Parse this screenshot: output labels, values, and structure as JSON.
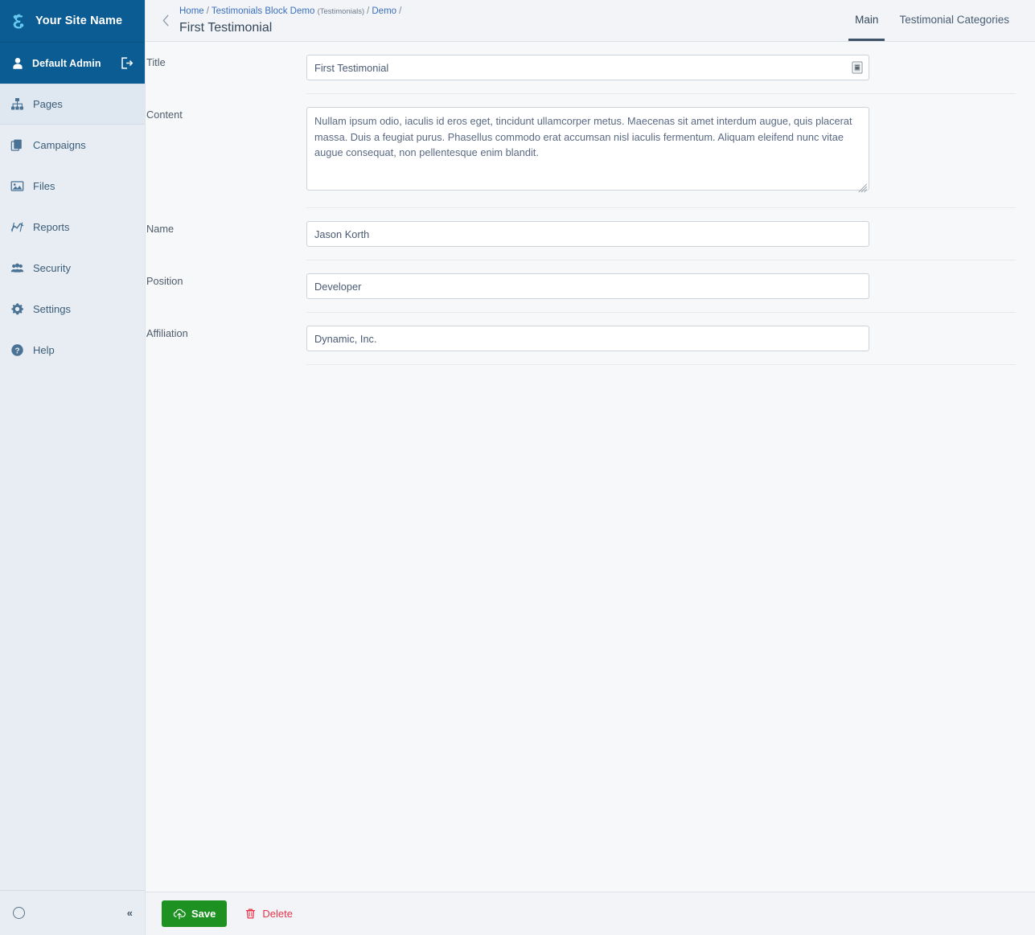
{
  "sidebar": {
    "brand": {
      "label": "Your Site Name",
      "logo_icon": "swirl-logo-icon"
    },
    "user": {
      "name": "Default Admin",
      "user_icon": "user-icon",
      "logout_icon": "logout-icon"
    },
    "items": [
      {
        "label": "Pages",
        "icon": "sitemap-icon",
        "active": true
      },
      {
        "label": "Campaigns",
        "icon": "copy-pages-icon",
        "active": false
      },
      {
        "label": "Files",
        "icon": "image-icon",
        "active": false
      },
      {
        "label": "Reports",
        "icon": "line-chart-icon",
        "active": false
      },
      {
        "label": "Security",
        "icon": "users-icon",
        "active": false
      },
      {
        "label": "Settings",
        "icon": "gear-icon",
        "active": false
      },
      {
        "label": "Help",
        "icon": "question-circle-icon",
        "active": false
      }
    ],
    "footer": {
      "status_icon": "circle-icon",
      "collapse_label": "«"
    }
  },
  "topbar": {
    "back_icon": "chevron-left-icon",
    "breadcrumb": [
      {
        "label": "Home",
        "sub": ""
      },
      {
        "label": "Testimonials Block Demo",
        "sub": "(Testimonials)"
      },
      {
        "label": "Demo",
        "sub": ""
      }
    ],
    "separator": "/",
    "page_title": "First Testimonial",
    "tabs": [
      {
        "label": "Main",
        "active": true
      },
      {
        "label": "Testimonial Categories",
        "active": false
      }
    ]
  },
  "form": {
    "fields": [
      {
        "label": "Title",
        "type": "text",
        "value": "First Testimonial",
        "placeholder": "",
        "icon": "insert-content-icon"
      },
      {
        "label": "Content",
        "type": "textarea",
        "value": "Nullam ipsum odio, iaculis id eros eget, tincidunt ullamcorper metus. Maecenas sit amet interdum augue, quis placerat massa. Duis a feugiat purus. Phasellus commodo erat accumsan nisl iaculis fermentum. Aliquam eleifend nunc vitae augue consequat, non pellentesque enim blandit.",
        "placeholder": ""
      },
      {
        "label": "Name",
        "type": "text",
        "value": "Jason Korth",
        "placeholder": ""
      },
      {
        "label": "Position",
        "type": "text",
        "value": "Developer",
        "placeholder": ""
      },
      {
        "label": "Affiliation",
        "type": "text",
        "value": "Dynamic, Inc.",
        "placeholder": ""
      }
    ]
  },
  "actions": {
    "save_label": "Save",
    "save_icon": "cloud-upload-icon",
    "delete_label": "Delete",
    "delete_icon": "trash-icon"
  },
  "colors": {
    "brand_blue": "#0b5c93",
    "sidebar_bg": "#e7edf3",
    "sidebar_active": "#dfe8f0",
    "link_blue": "#3b6fbe",
    "save_green": "#1d9121",
    "delete_red": "#e8344b",
    "text_dark": "#35495c"
  }
}
